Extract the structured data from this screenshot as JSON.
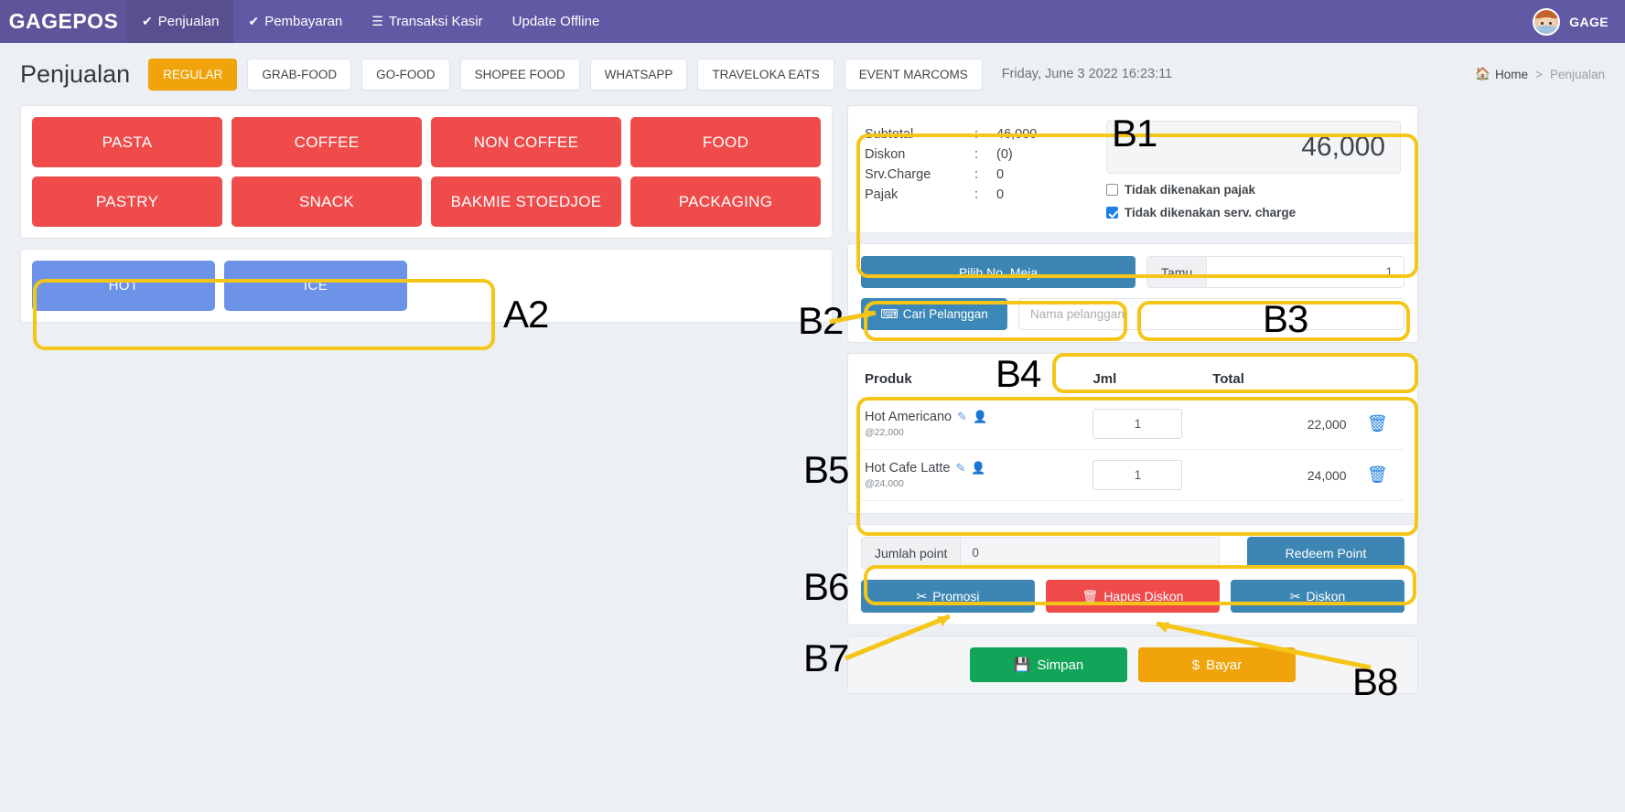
{
  "topnav": {
    "brand": "GAGEPOS",
    "items": [
      {
        "label": "Penjualan",
        "icon": "check-icon",
        "active": true
      },
      {
        "label": "Pembayaran",
        "icon": "check-icon",
        "active": false
      },
      {
        "label": "Transaksi Kasir",
        "icon": "list-icon",
        "active": false
      },
      {
        "label": "Update Offline",
        "icon": "",
        "active": false
      }
    ],
    "username": "GAGE"
  },
  "subheader": {
    "page_title": "Penjualan",
    "channels": [
      {
        "label": "REGULAR",
        "active": true
      },
      {
        "label": "GRAB-FOOD",
        "active": false
      },
      {
        "label": "GO-FOOD",
        "active": false
      },
      {
        "label": "SHOPEE FOOD",
        "active": false
      },
      {
        "label": "WHATSAPP",
        "active": false
      },
      {
        "label": "TRAVELOKA EATS",
        "active": false
      },
      {
        "label": "EVENT MARCOMS",
        "active": false
      }
    ],
    "datetime": "Friday, June 3 2022 16:23:11",
    "breadcrumb": {
      "home": "Home",
      "sep": ">",
      "current": "Penjualan"
    }
  },
  "categories": [
    "PASTA",
    "COFFEE",
    "NON COFFEE",
    "FOOD",
    "PASTRY",
    "SNACK",
    "BAKMIE STOEDJOE",
    "PACKAGING"
  ],
  "temperatures": [
    "HOT",
    "ICE"
  ],
  "summary": {
    "rows": [
      {
        "label": "Subtotal",
        "sep": ":",
        "value": "46,000"
      },
      {
        "label": "Diskon",
        "sep": ":",
        "value": "(0)"
      },
      {
        "label": "Srv.Charge",
        "sep": ":",
        "value": "0"
      },
      {
        "label": "Pajak",
        "sep": ":",
        "value": "0"
      }
    ],
    "grand_total": "46,000",
    "checkbox_tax": {
      "label": "Tidak dikenakan pajak",
      "checked": false
    },
    "checkbox_service": {
      "label": "Tidak dikenakan serv. charge",
      "checked": true
    }
  },
  "table_section": {
    "pilih_meja": "Pilih No. Meja",
    "tamu_label": "Tamu",
    "tamu_value": "1"
  },
  "customer": {
    "cari_label": "Cari Pelanggan",
    "cari_icon": "keyboard-icon",
    "name_placeholder": "Nama pelanggan",
    "name_value": ""
  },
  "products": {
    "headers": [
      "Produk",
      "Jml",
      "Total",
      ""
    ],
    "rows": [
      {
        "name": "Hot Americano",
        "price": "@22,000",
        "qty": "1",
        "total": "22,000",
        "edit_icon": "pencil-icon",
        "member_icon": "person-icon",
        "delete_icon": "trash-icon"
      },
      {
        "name": "Hot Cafe Latte",
        "price": "@24,000",
        "qty": "1",
        "total": "24,000",
        "edit_icon": "pencil-icon",
        "member_icon": "person-icon",
        "delete_icon": "trash-icon"
      }
    ]
  },
  "points": {
    "label": "Jumlah point",
    "value": "0",
    "redeem_label": "Redeem Point"
  },
  "actions": {
    "promosi": "Promosi",
    "hapus_diskon": "Hapus Diskon",
    "diskon": "Diskon",
    "simpan": "Simpan",
    "bayar": "Bayar"
  },
  "annotations": [
    {
      "id": "A2",
      "label": "A2"
    },
    {
      "id": "B1",
      "label": "B1"
    },
    {
      "id": "B2",
      "label": "B2"
    },
    {
      "id": "B3",
      "label": "B3"
    },
    {
      "id": "B4",
      "label": "B4"
    },
    {
      "id": "B5",
      "label": "B5"
    },
    {
      "id": "B6",
      "label": "B6"
    },
    {
      "id": "B7",
      "label": "B7"
    },
    {
      "id": "B8",
      "label": "B8"
    }
  ],
  "colors": {
    "nav": "#6259a5",
    "category": "#ef4b4b",
    "temp": "#6c93e8",
    "accent_orange": "#f0a30a",
    "blue": "#3d86b4",
    "green": "#10a558",
    "annotation": "#f5c518"
  }
}
